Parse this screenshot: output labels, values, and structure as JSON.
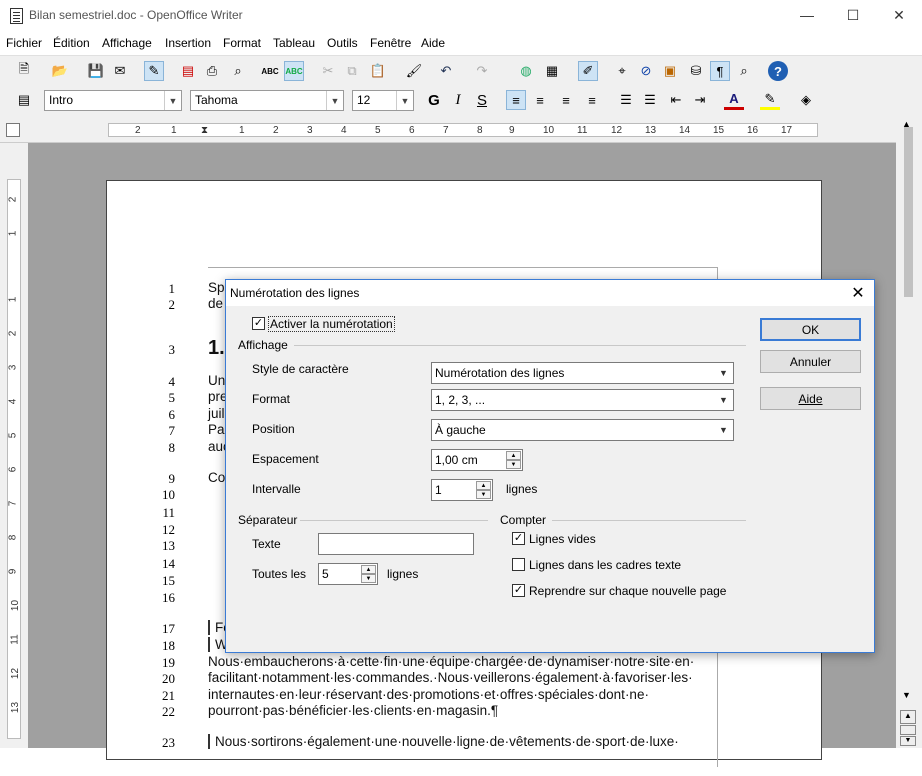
{
  "window": {
    "title": "Bilan semestriel.doc - OpenOffice Writer",
    "minimize": "—",
    "maximize": "☐",
    "close": "✕"
  },
  "menu": [
    "Fichier",
    "Édition",
    "Affichage",
    "Insertion",
    "Format",
    "Tableau",
    "Outils",
    "Fenêtre",
    "Aide"
  ],
  "formatting": {
    "style": "Intro",
    "font": "Tahoma",
    "size": "12"
  },
  "ruler": {
    "h": [
      "2",
      "1",
      "1",
      "2",
      "3",
      "4",
      "5",
      "6",
      "7",
      "8",
      "9",
      "10",
      "11",
      "12",
      "13",
      "14",
      "15",
      "16",
      "17"
    ],
    "v": [
      "2",
      "1",
      "1",
      "2",
      "3",
      "4",
      "5",
      "6",
      "7",
      "8",
      "9",
      "10",
      "11",
      "12",
      "13"
    ]
  },
  "document": {
    "line_numbers": [
      "1",
      "2",
      "3",
      "4",
      "5",
      "6",
      "7",
      "8",
      "9",
      "10",
      "11",
      "12",
      "13",
      "14",
      "15",
      "16",
      "17",
      "18",
      "19",
      "20",
      "21",
      "22",
      "23"
    ],
    "fragments": [
      "Sp",
      "de",
      "1.",
      "Un",
      "pre",
      "juil",
      "Pa",
      "auc",
      "Co",
      "Fo",
      "W"
    ],
    "lines": [
      "Nous·embaucherons·à·cette·fin·une·équipe·chargée·de·dynamiser·notre·site·en·",
      "facilitant·notamment·les·commandes.·Nous·veillerons·également·à·favoriser·les·",
      "internautes·en·leur·réservant·des·promotions·et·offres·spéciales·dont·ne·",
      "pourront·pas·bénéficier·les·clients·en·magasin.¶",
      "Nous·sortirons·également·une·nouvelle·ligne·de·vêtements·de·sport·de·luxe·"
    ]
  },
  "dialog": {
    "title": "Numérotation des lignes",
    "close": "✕",
    "activate": {
      "label": "Activer la numérotation",
      "checked": "✓"
    },
    "affichage": "Affichage",
    "fields": {
      "style_label": "Style de caractère",
      "style_value": "Numérotation des lignes",
      "format_label": "Format",
      "format_value": "1, 2, 3, ...",
      "position_label": "Position",
      "position_value": "À gauche",
      "spacing_label": "Espacement",
      "spacing_value": "1,00 cm",
      "interval_label": "Intervalle",
      "interval_value": "1",
      "interval_unit": "lignes"
    },
    "separator": {
      "title": "Séparateur",
      "text_label": "Texte",
      "text_value": "",
      "every_label": "Toutes les",
      "every_value": "5",
      "every_unit": "lignes"
    },
    "count": {
      "title": "Compter",
      "empty": "Lignes vides",
      "empty_checked": "✓",
      "frames": "Lignes dans les cadres texte",
      "frames_checked": "",
      "restart": "Reprendre sur chaque nouvelle page",
      "restart_checked": "✓"
    },
    "buttons": {
      "ok": "OK",
      "cancel": "Annuler",
      "help": "Aide"
    }
  }
}
